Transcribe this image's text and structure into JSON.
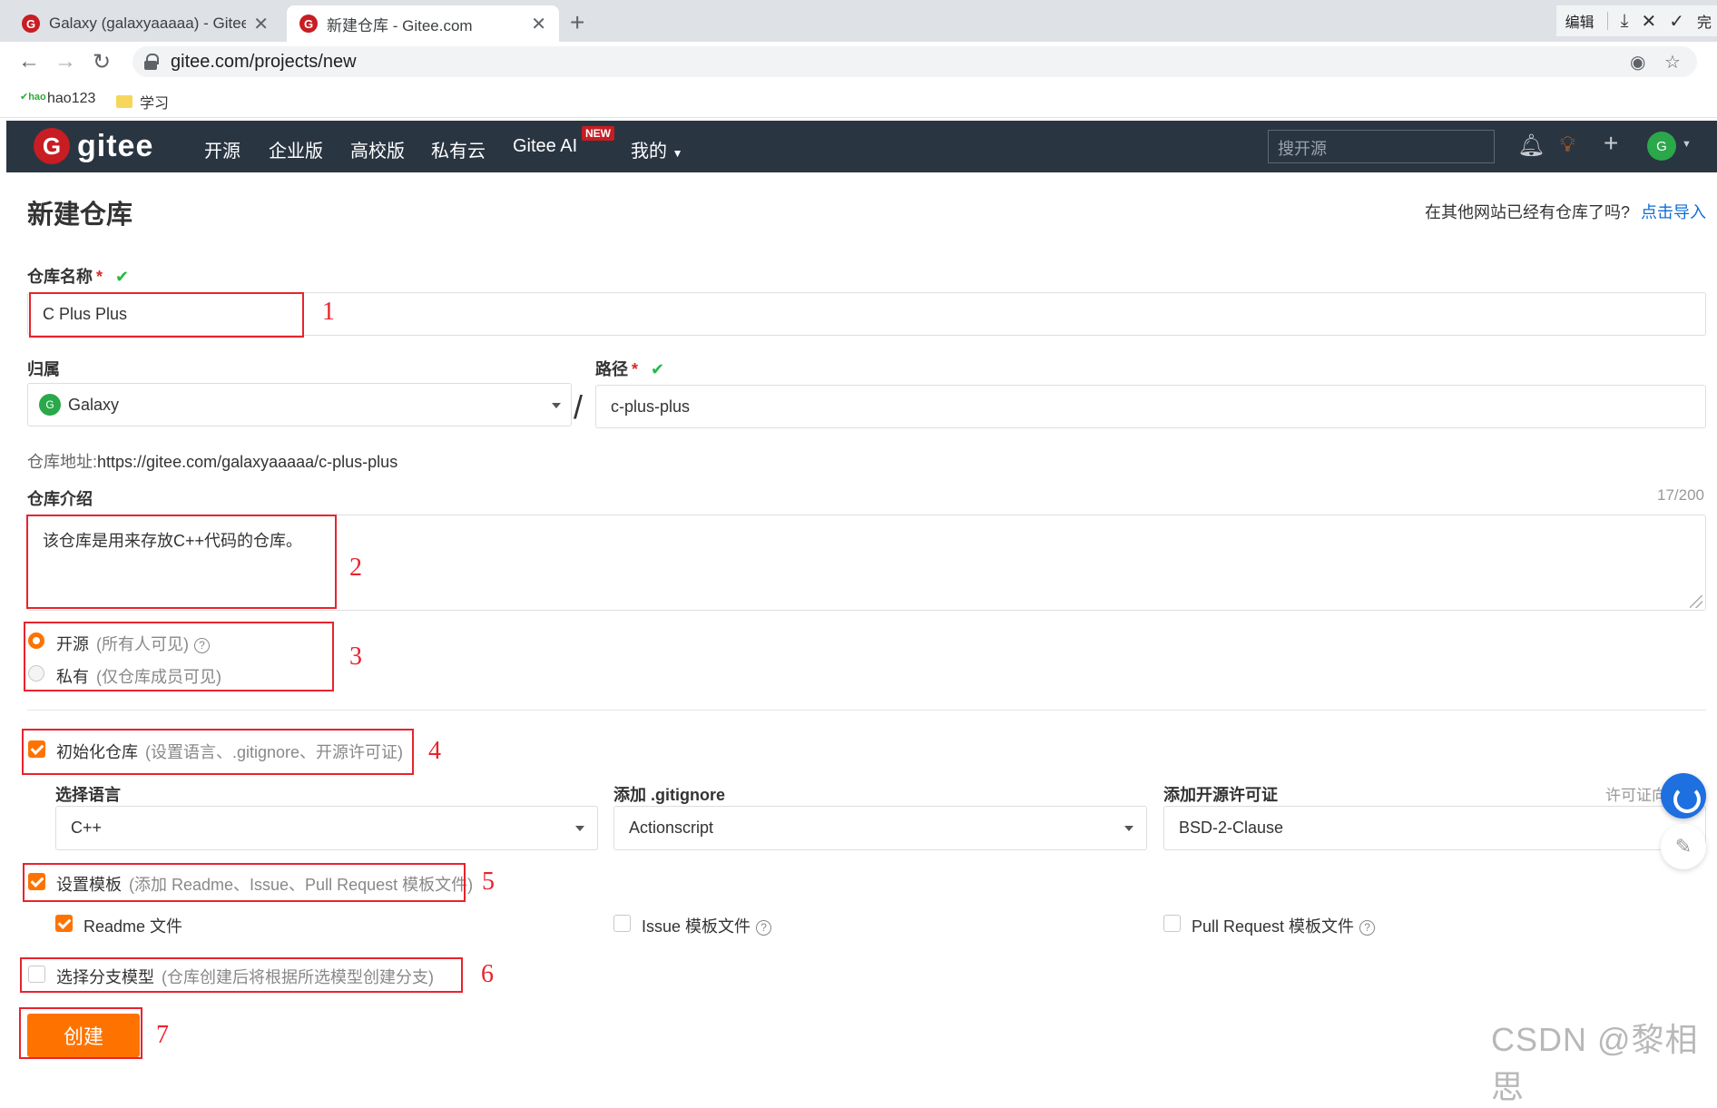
{
  "browser": {
    "tabs": [
      {
        "title": "Galaxy (galaxyaaaaa) - Gitee.cc",
        "active": false
      },
      {
        "title": "新建仓库 - Gitee.com",
        "active": true
      }
    ],
    "url": "gitee.com/projects/new",
    "toolbar_right": {
      "edit_label": "编辑",
      "cut_label": "完"
    },
    "bookmarks": [
      {
        "label": "hao123",
        "icon": "hao123-icon"
      },
      {
        "label": "学习",
        "icon": "folder-icon"
      }
    ]
  },
  "gitee_header": {
    "logo_text": "gitee",
    "nav": [
      "开源",
      "企业版",
      "高校版",
      "私有云",
      "Gitee AI",
      "我的"
    ],
    "new_badge": "NEW",
    "search_placeholder": "搜开源",
    "avatar_letter": "G"
  },
  "page": {
    "title": "新建仓库",
    "import_question": "在其他网站已经有仓库了吗?",
    "import_link": "点击导入"
  },
  "form": {
    "repo_name": {
      "label": "仓库名称",
      "value": "C Plus Plus"
    },
    "owner": {
      "label": "归属",
      "value": "Galaxy",
      "avatar_letter": "G"
    },
    "path": {
      "label": "路径",
      "value": "c-plus-plus"
    },
    "path_separator": "/",
    "repo_address": {
      "label": "仓库地址:",
      "value": "https://gitee.com/galaxyaaaaa/c-plus-plus"
    },
    "description": {
      "label": "仓库介绍",
      "value": "该仓库是用来存放C++代码的仓库。",
      "counter": "17/200"
    },
    "visibility": [
      {
        "label": "开源",
        "hint": "(所有人可见)",
        "selected": true
      },
      {
        "label": "私有",
        "hint": "(仅仓库成员可见)",
        "selected": false
      }
    ],
    "init_repo": {
      "label": "初始化仓库",
      "hint": "(设置语言、.gitignore、开源许可证)",
      "checked": true
    },
    "language": {
      "label": "选择语言",
      "value": "C++"
    },
    "gitignore": {
      "label": "添加 .gitignore",
      "value": "Actionscript"
    },
    "license": {
      "label": "添加开源许可证",
      "value": "BSD-2-Clause",
      "help": "许可证向"
    },
    "template": {
      "label": "设置模板",
      "hint": "(添加 Readme、Issue、Pull Request 模板文件)",
      "checked": true
    },
    "template_options": [
      {
        "label": "Readme 文件",
        "checked": true,
        "help": false
      },
      {
        "label": "Issue 模板文件",
        "checked": false,
        "help": true
      },
      {
        "label": "Pull Request 模板文件",
        "checked": false,
        "help": true
      }
    ],
    "branch_model": {
      "label": "选择分支模型",
      "hint": "(仓库创建后将根据所选模型创建分支)",
      "checked": false
    },
    "submit_label": "创建"
  },
  "annotations": [
    "1",
    "2",
    "3",
    "4",
    "5",
    "6",
    "7"
  ],
  "watermark": "CSDN @黎相思",
  "colors": {
    "brand_red": "#c71d23",
    "accent_orange": "#fe7300",
    "header_bg": "#2a3542",
    "annotation_red": "#e8232c",
    "link_blue": "#0e6ed6"
  }
}
